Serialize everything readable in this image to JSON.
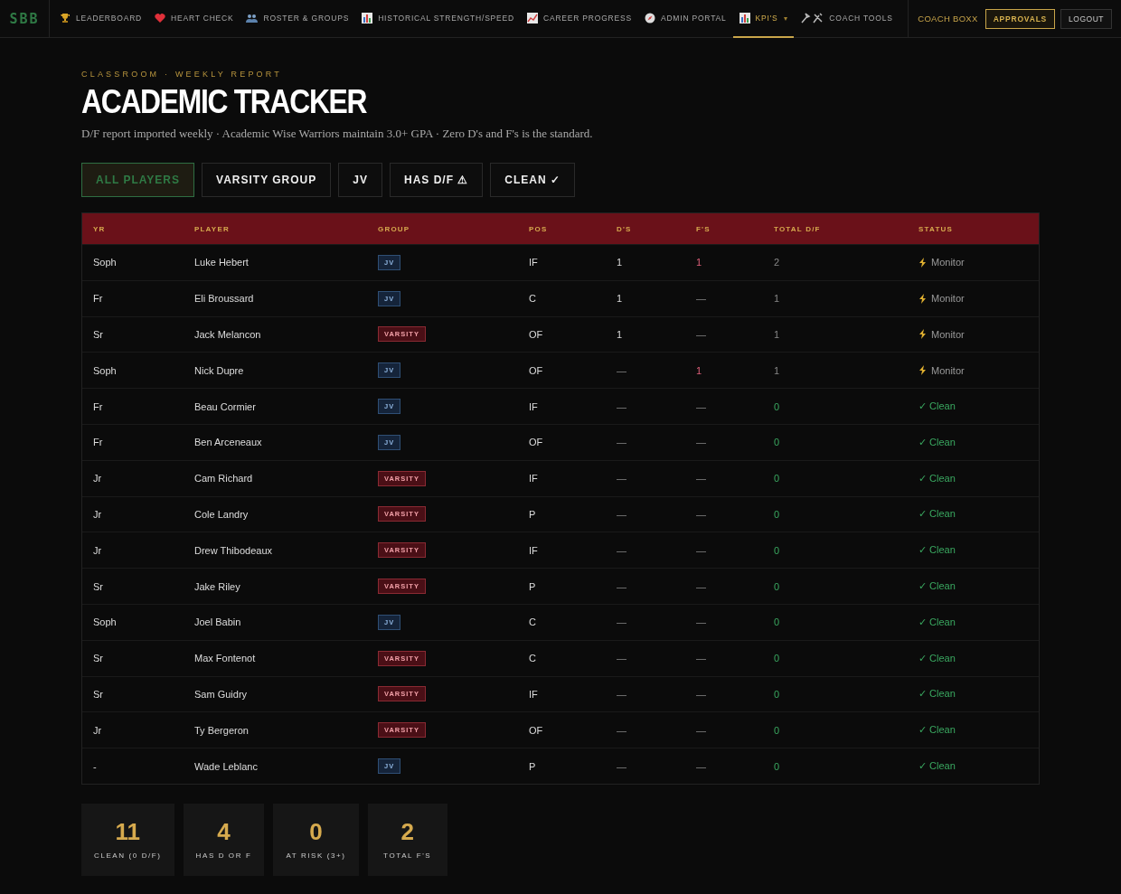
{
  "nav": {
    "logo": "SBB",
    "items": [
      {
        "label": "LEADERBOARD",
        "selected": false
      },
      {
        "label": "HEART CHECK",
        "selected": false
      },
      {
        "label": "ROSTER & GROUPS",
        "selected": false
      },
      {
        "label": "HISTORICAL STRENGTH/SPEED",
        "selected": false
      },
      {
        "label": "CAREER PROGRESS",
        "selected": false
      },
      {
        "label": "ADMIN PORTAL",
        "selected": false
      },
      {
        "label": "KPI'S",
        "selected": true,
        "caret": "▾"
      },
      {
        "label": "COACH TOOLS",
        "selected": false
      }
    ],
    "user": "COACH BOXX",
    "approvals": "APPROVALS",
    "logout": "LOGOUT"
  },
  "header": {
    "eyebrow": "CLASSROOM · WEEKLY REPORT",
    "title": "ACADEMIC TRACKER",
    "subtitle": "D/F report imported weekly · Academic Wise Warriors maintain 3.0+ GPA · Zero D's and F's is the standard."
  },
  "filters": [
    {
      "label": "ALL PLAYERS",
      "selected": true
    },
    {
      "label": "VARSITY GROUP",
      "selected": false
    },
    {
      "label": "JV",
      "selected": false
    },
    {
      "label": "HAS D/F ⚠",
      "selected": false
    },
    {
      "label": "CLEAN ✓",
      "selected": false
    }
  ],
  "table": {
    "columns": [
      "YR",
      "PLAYER",
      "GROUP",
      "POS",
      "D'S",
      "F'S",
      "TOTAL D/F",
      "STATUS"
    ],
    "rows": [
      {
        "yr": "Soph",
        "player": "Luke Hebert",
        "group": {
          "label": "JV",
          "kind": "jv"
        },
        "pos": "IF",
        "ds": "1",
        "fs": "1",
        "fs_flag": true,
        "total": "2",
        "status": {
          "label": "Monitor",
          "kind": "monitor"
        }
      },
      {
        "yr": "Fr",
        "player": "Eli Broussard",
        "group": {
          "label": "JV",
          "kind": "jv"
        },
        "pos": "C",
        "ds": "1",
        "fs": "—",
        "fs_flag": false,
        "total": "1",
        "status": {
          "label": "Monitor",
          "kind": "monitor"
        }
      },
      {
        "yr": "Sr",
        "player": "Jack Melancon",
        "group": {
          "label": "VARSITY",
          "kind": "varsity"
        },
        "pos": "OF",
        "ds": "1",
        "fs": "—",
        "fs_flag": false,
        "total": "1",
        "status": {
          "label": "Monitor",
          "kind": "monitor"
        }
      },
      {
        "yr": "Soph",
        "player": "Nick Dupre",
        "group": {
          "label": "JV",
          "kind": "jv"
        },
        "pos": "OF",
        "ds": "—",
        "fs": "1",
        "fs_flag": true,
        "total": "1",
        "status": {
          "label": "Monitor",
          "kind": "monitor"
        }
      },
      {
        "yr": "Fr",
        "player": "Beau Cormier",
        "group": {
          "label": "JV",
          "kind": "jv"
        },
        "pos": "IF",
        "ds": "—",
        "fs": "—",
        "fs_flag": false,
        "total": "0",
        "status": {
          "label": "✓ Clean",
          "kind": "clean"
        }
      },
      {
        "yr": "Fr",
        "player": "Ben Arceneaux",
        "group": {
          "label": "JV",
          "kind": "jv"
        },
        "pos": "OF",
        "ds": "—",
        "fs": "—",
        "fs_flag": false,
        "total": "0",
        "status": {
          "label": "✓ Clean",
          "kind": "clean"
        }
      },
      {
        "yr": "Jr",
        "player": "Cam Richard",
        "group": {
          "label": "VARSITY",
          "kind": "varsity"
        },
        "pos": "IF",
        "ds": "—",
        "fs": "—",
        "fs_flag": false,
        "total": "0",
        "status": {
          "label": "✓ Clean",
          "kind": "clean"
        }
      },
      {
        "yr": "Jr",
        "player": "Cole Landry",
        "group": {
          "label": "VARSITY",
          "kind": "varsity"
        },
        "pos": "P",
        "ds": "—",
        "fs": "—",
        "fs_flag": false,
        "total": "0",
        "status": {
          "label": "✓ Clean",
          "kind": "clean"
        }
      },
      {
        "yr": "Jr",
        "player": "Drew Thibodeaux",
        "group": {
          "label": "VARSITY",
          "kind": "varsity"
        },
        "pos": "IF",
        "ds": "—",
        "fs": "—",
        "fs_flag": false,
        "total": "0",
        "status": {
          "label": "✓ Clean",
          "kind": "clean"
        }
      },
      {
        "yr": "Sr",
        "player": "Jake Riley",
        "group": {
          "label": "VARSITY",
          "kind": "varsity"
        },
        "pos": "P",
        "ds": "—",
        "fs": "—",
        "fs_flag": false,
        "total": "0",
        "status": {
          "label": "✓ Clean",
          "kind": "clean"
        }
      },
      {
        "yr": "Soph",
        "player": "Joel Babin",
        "group": {
          "label": "JV",
          "kind": "jv"
        },
        "pos": "C",
        "ds": "—",
        "fs": "—",
        "fs_flag": false,
        "total": "0",
        "status": {
          "label": "✓ Clean",
          "kind": "clean"
        }
      },
      {
        "yr": "Sr",
        "player": "Max Fontenot",
        "group": {
          "label": "VARSITY",
          "kind": "varsity"
        },
        "pos": "C",
        "ds": "—",
        "fs": "—",
        "fs_flag": false,
        "total": "0",
        "status": {
          "label": "✓ Clean",
          "kind": "clean"
        }
      },
      {
        "yr": "Sr",
        "player": "Sam Guidry",
        "group": {
          "label": "VARSITY",
          "kind": "varsity"
        },
        "pos": "IF",
        "ds": "—",
        "fs": "—",
        "fs_flag": false,
        "total": "0",
        "status": {
          "label": "✓ Clean",
          "kind": "clean"
        }
      },
      {
        "yr": "Jr",
        "player": "Ty Bergeron",
        "group": {
          "label": "VARSITY",
          "kind": "varsity"
        },
        "pos": "OF",
        "ds": "—",
        "fs": "—",
        "fs_flag": false,
        "total": "0",
        "status": {
          "label": "✓ Clean",
          "kind": "clean"
        }
      },
      {
        "yr": "-",
        "player": "Wade Leblanc",
        "group": {
          "label": "JV",
          "kind": "jv"
        },
        "pos": "P",
        "ds": "—",
        "fs": "—",
        "fs_flag": false,
        "total": "0",
        "status": {
          "label": "✓ Clean",
          "kind": "clean"
        }
      }
    ]
  },
  "stats": [
    {
      "value": "11",
      "label": "CLEAN (0 D/F)"
    },
    {
      "value": "4",
      "label": "HAS D OR F"
    },
    {
      "value": "0",
      "label": "AT RISK (3+)"
    },
    {
      "value": "2",
      "label": "TOTAL F'S"
    }
  ]
}
